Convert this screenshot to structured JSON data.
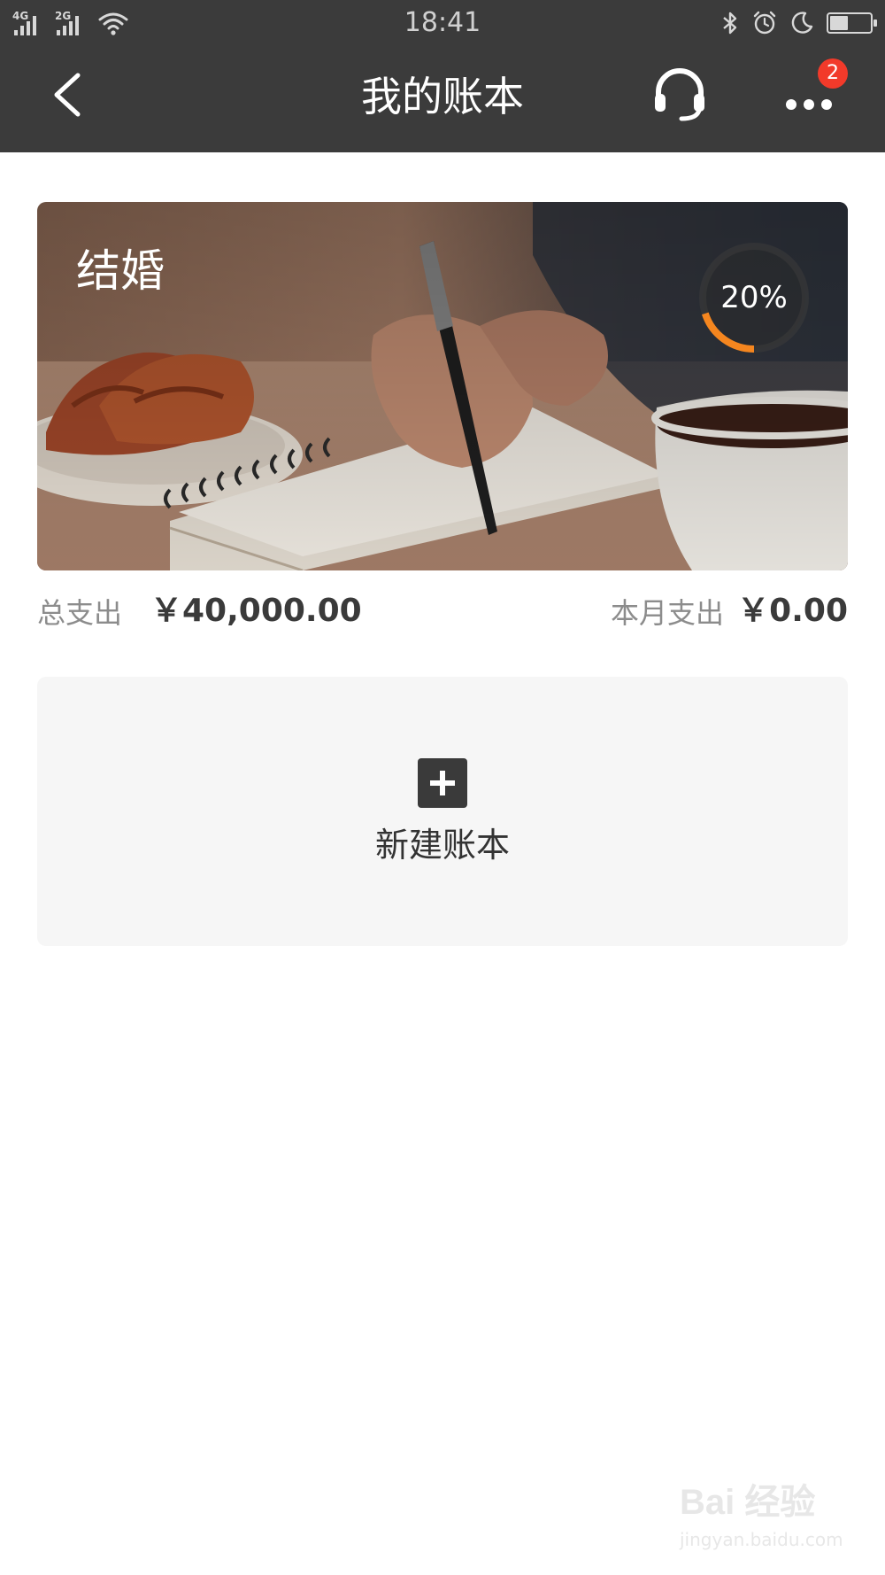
{
  "status_bar": {
    "signal1_tag": "4G",
    "signal2_tag": "2G",
    "time": "18:41",
    "battery_level": 0.45
  },
  "nav": {
    "title": "我的账本",
    "notification_count": "2"
  },
  "book": {
    "name": "结婚",
    "progress_percent": 20,
    "progress_label": "20%",
    "total_label": "总支出",
    "total_value": "￥40,000.00",
    "month_label": "本月支出",
    "month_value": "￥0.00"
  },
  "new_book": {
    "label": "新建账本"
  },
  "watermark": {
    "logo": "Bai 经验",
    "url": "jingyan.baidu.com"
  },
  "colors": {
    "header_bg": "#3b3b3b",
    "progress_accent": "#f5861f",
    "badge": "#f23a2a",
    "new_card_bg": "#f6f6f6"
  },
  "icons": {
    "back": "chevron-left-icon",
    "service": "headset-icon",
    "more": "more-dots-icon",
    "add": "plus-icon",
    "bluetooth": "bluetooth-icon",
    "alarm": "alarm-clock-icon",
    "dnd": "moon-icon",
    "wifi": "wifi-icon"
  }
}
